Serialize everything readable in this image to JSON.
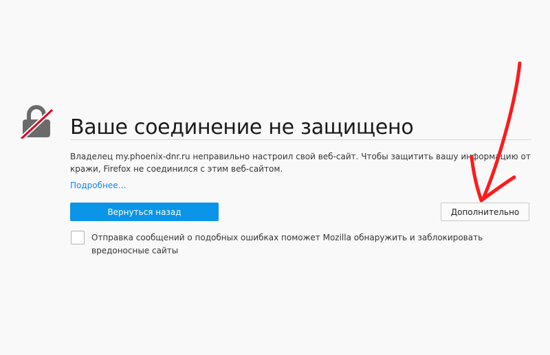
{
  "error_page": {
    "title": "Ваше соединение не защищено",
    "description": "Владелец my.phoenix-dnr.ru неправильно настроил свой веб-сайт. Чтобы защитить вашу информацию от кражи, Firefox не соединился с этим веб-сайтом.",
    "learn_more_label": "Подробнее…",
    "go_back_label": "Вернуться назад",
    "advanced_label": "Дополнительно",
    "report_checkbox_label": "Отправка сообщений о подобных ошибках поможет Mozilla обнаружить и заблокировать вредоносные сайты",
    "report_checked": false
  },
  "icons": {
    "lock": "broken-lock-icon",
    "annotation": "red-hand-drawn-arrow"
  },
  "colors": {
    "background": "#f9f9fa",
    "primary_button": "#0a95e8",
    "link": "#0a84ff",
    "lock_gray": "#6b6b6b",
    "strike_red": "#d70022",
    "annotation_red": "#ff1a1a"
  }
}
